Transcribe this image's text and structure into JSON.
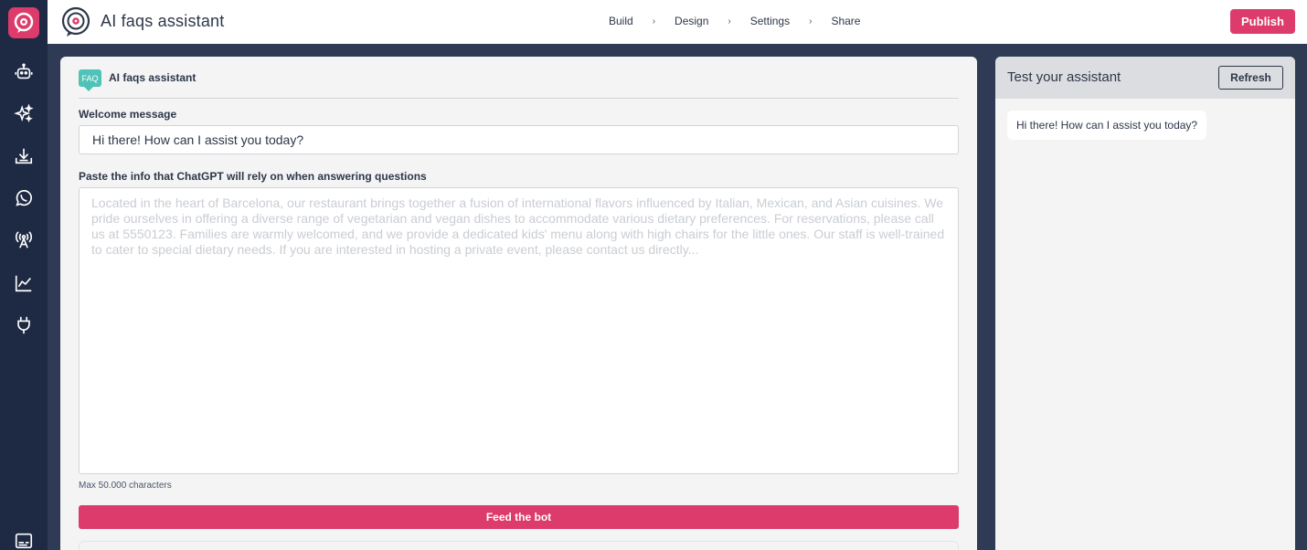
{
  "header": {
    "app_title": "AI faqs assistant",
    "steps": [
      "Build",
      "Design",
      "Settings",
      "Share"
    ],
    "step_separator": "›",
    "publish_label": "Publish"
  },
  "sidebar": {
    "items": [
      {
        "icon": "robot-icon"
      },
      {
        "icon": "sparkles-icon"
      },
      {
        "icon": "download-tray-icon"
      },
      {
        "icon": "whatsapp-icon"
      },
      {
        "icon": "broadcast-antenna-icon"
      },
      {
        "icon": "analytics-chart-icon"
      },
      {
        "icon": "plug-icon"
      }
    ],
    "bottom_icon": "chat-window-icon"
  },
  "editor": {
    "badge": "FAQ",
    "title": "AI faqs assistant",
    "welcome_label": "Welcome message",
    "welcome_value": "Hi there! How can I assist you today?",
    "info_label": "Paste the info that ChatGPT will rely on when answering questions",
    "info_placeholder": "Located in the heart of Barcelona, our restaurant brings together a fusion of international flavors influenced by Italian, Mexican, and Asian cuisines. We pride ourselves in offering a diverse range of vegetarian and vegan dishes to accommodate various dietary preferences. For reservations, please call us at 5550123. Families are warmly welcomed, and we provide a dedicated kids' menu along with high chairs for the little ones. Our staff is well-trained to cater to special dietary needs. If you are interested in hosting a private event, please contact us directly...",
    "max_hint": "Max 50.000 characters",
    "feed_label": "Feed the bot"
  },
  "test_panel": {
    "title": "Test your assistant",
    "refresh_label": "Refresh",
    "messages": [
      "Hi there! How can I assist you today?"
    ]
  },
  "colors": {
    "accent": "#dc3b6b",
    "sidebar_bg": "#1e2a44",
    "page_bg": "#2f3b55",
    "faq_badge": "#4fc3b8"
  }
}
